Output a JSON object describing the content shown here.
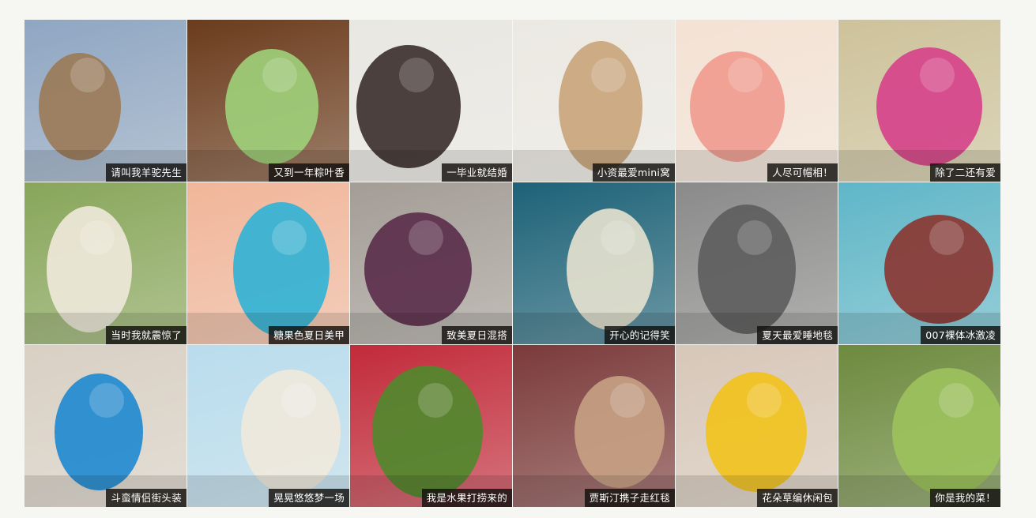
{
  "gallery": {
    "items": [
      {
        "caption": "请叫我羊驼先生",
        "icon": "giraffe-photo",
        "bg": "#8fa6c2",
        "accent": "#9b7a55"
      },
      {
        "caption": "又到一年粽叶香",
        "icon": "zongzi-photo",
        "bg": "#6b3b1c",
        "accent": "#9ed27a"
      },
      {
        "caption": "一毕业就结婚",
        "icon": "couple-photo",
        "bg": "#e9e7e2",
        "accent": "#3a2e2a"
      },
      {
        "caption": "小资最爱mini窝",
        "icon": "living-room-photo",
        "bg": "#ece9e3",
        "accent": "#c8a47a"
      },
      {
        "caption": "人尽可帽相！",
        "icon": "hat-photo",
        "bg": "#f4e2d4",
        "accent": "#f19a8e"
      },
      {
        "caption": "除了二还有爱",
        "icon": "girl-dog-photo",
        "bg": "#cdc29a",
        "accent": "#d6408a"
      },
      {
        "caption": "当时我就震惊了",
        "icon": "radish-man-photo",
        "bg": "#88a65a",
        "accent": "#efe9dc"
      },
      {
        "caption": "糖果色夏日美甲",
        "icon": "nails-photo",
        "bg": "#f1b69a",
        "accent": "#2fb3d6"
      },
      {
        "caption": "致美夏日混搭",
        "icon": "fashion-girl-photo",
        "bg": "#a39d96",
        "accent": "#5a2c4a"
      },
      {
        "caption": "开心的记得笑",
        "icon": "beluga-photo",
        "bg": "#1d6278",
        "accent": "#e7e2cf"
      },
      {
        "caption": "夏天最爱睡地毯",
        "icon": "rug-photo",
        "bg": "#8a8a8a",
        "accent": "#5d5d5d"
      },
      {
        "caption": "007裸体冰激凌",
        "icon": "icecream-photo",
        "bg": "#5fb6c8",
        "accent": "#8b3530"
      },
      {
        "caption": "斗蛮情侣街头装",
        "icon": "couple-fashion-photo",
        "bg": "#d9d0c4",
        "accent": "#1e88d0"
      },
      {
        "caption": "晃晃悠悠梦一场",
        "icon": "hammock-photo",
        "bg": "#b9dced",
        "accent": "#efe9dc"
      },
      {
        "caption": "我是水果打捞来的",
        "icon": "fruit-baby-photo",
        "bg": "#c22a3a",
        "accent": "#4f8a2c"
      },
      {
        "caption": "贾斯汀携子走红毯",
        "icon": "justin-baby-photo",
        "bg": "#7b3a3a",
        "accent": "#c7a184"
      },
      {
        "caption": "花朵草编休闲包",
        "icon": "straw-bag-photo",
        "bg": "#d7c7b9",
        "accent": "#f2c21b"
      },
      {
        "caption": "你是我的菜！",
        "icon": "frog-photo",
        "bg": "#6d8a3e",
        "accent": "#9cc25c"
      }
    ]
  }
}
